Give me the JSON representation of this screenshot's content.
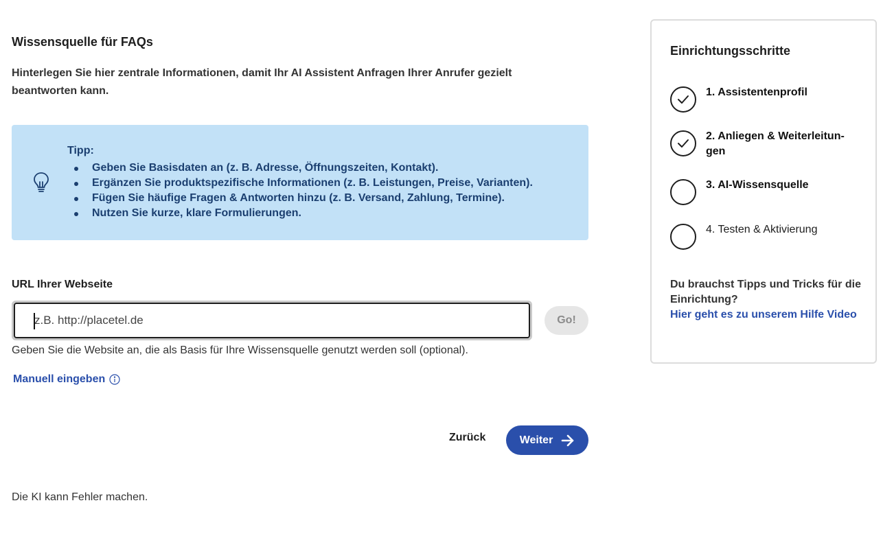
{
  "main": {
    "title": "Wissensquelle für FAQs",
    "intro": "Hinterlegen Sie hier zentrale Informationen, damit Ihr AI Assistent Anfragen Ihrer Anrufer gezielt beantworten kann.",
    "tip": {
      "title": "Tipp:",
      "icon": "lightbulb-icon",
      "items": [
        "Geben Sie Basisdaten an (z. B. Adresse, Öffnungszeiten, Kontakt).",
        "Ergänzen Sie produktspezifische Informationen (z. B. Leistungen, Preise, Varianten).",
        "Fügen Sie häufige Fragen & Antworten hinzu (z. B. Versand, Zahlung, Termine).",
        "Nutzen Sie kurze, klare Formulierungen."
      ]
    },
    "url": {
      "label": "URL Ihrer Webseite",
      "value": "",
      "placeholder": "z.B. http://placetel.de",
      "go_label": "Go!",
      "help": "Geben Sie die Website an, die als Basis für Ihre Wissensquelle genutzt werden soll (optional).",
      "manual_label": "Manuell eingeben"
    },
    "nav": {
      "back_label": "Zurück",
      "next_label": "Weiter"
    },
    "disclaimer": "Die KI kann Fehler machen."
  },
  "sidebar": {
    "title": "Einrichtungsschritte",
    "steps": [
      {
        "label": "1. Assistentenprofil",
        "status": "done"
      },
      {
        "label": "2. Anliegen & Weiterleitun-gen",
        "status": "done"
      },
      {
        "label": "3. AI-Wissensquelle",
        "status": "active"
      },
      {
        "label": "4. Testen & Aktivierung",
        "status": "pending"
      }
    ],
    "help_text": "Du brauchst Tipps und Tricks für die Einrichtung?",
    "help_link": "Hier geht es zu unserem Hilfe Video"
  },
  "colors": {
    "accent": "#2a4fab",
    "tip_background": "#c2e1f7",
    "tip_text": "#1b3f70"
  }
}
